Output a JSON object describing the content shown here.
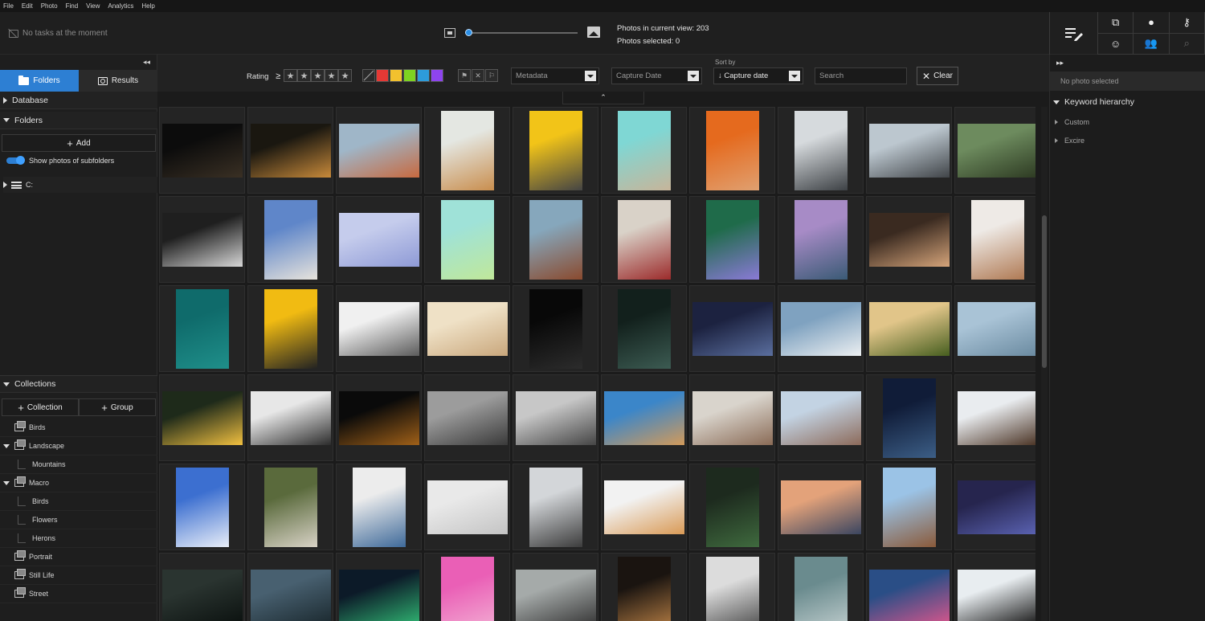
{
  "menu": [
    "File",
    "Edit",
    "Photo",
    "Find",
    "View",
    "Analytics",
    "Help"
  ],
  "header": {
    "tasks_text": "No tasks at the moment",
    "photos_in_view": "Photos in current view: 203",
    "photos_selected": "Photos selected: 0",
    "zoom_level": 0.02
  },
  "left": {
    "tab_folders": "Folders",
    "tab_results": "Results",
    "database": "Database",
    "folders": "Folders",
    "add": "Add",
    "show_subfolders": "Show photos of subfolders",
    "drive": "C:",
    "collections": "Collections",
    "collection_btn": "Collection",
    "group_btn": "Group",
    "items": [
      {
        "label": "Birds",
        "type": "collection",
        "level": 0
      },
      {
        "label": "Landscape",
        "type": "group",
        "level": 0
      },
      {
        "label": "Mountains",
        "type": "child",
        "level": 1
      },
      {
        "label": "Macro",
        "type": "group",
        "level": 0
      },
      {
        "label": "Birds",
        "type": "child",
        "level": 1
      },
      {
        "label": "Flowers",
        "type": "child",
        "level": 1
      },
      {
        "label": "Herons",
        "type": "child",
        "level": 1
      },
      {
        "label": "Portrait",
        "type": "collection",
        "level": 0
      },
      {
        "label": "Still Life",
        "type": "collection",
        "level": 0
      },
      {
        "label": "Street",
        "type": "collection",
        "level": 0
      }
    ]
  },
  "filter": {
    "rating_label": "Rating",
    "rating_op": "≥",
    "colors": [
      "#e53935",
      "#f2c12e",
      "#7ed321",
      "#2d9cdb",
      "#8e44ef"
    ],
    "metadata": "Metadata",
    "capture_date": "Capture Date",
    "sort_by_label": "Sort by",
    "sort_value": "↓ Capture date",
    "search_placeholder": "Search",
    "clear": "Clear"
  },
  "right": {
    "no_photo": "No photo selected",
    "keyword_hierarchy": "Keyword hierarchy",
    "keywords": [
      "Custom",
      "Excire"
    ]
  },
  "thumbs": [
    {
      "o": "l",
      "c": [
        "#0c0c0c",
        "#3a3024"
      ]
    },
    {
      "o": "l",
      "c": [
        "#1a1710",
        "#c88a3a"
      ]
    },
    {
      "o": "l",
      "c": [
        "#9fb6c8",
        "#c7693f"
      ]
    },
    {
      "o": "p",
      "c": [
        "#e4e7e2",
        "#c98e4e"
      ]
    },
    {
      "o": "p",
      "c": [
        "#f2c418",
        "#444"
      ]
    },
    {
      "o": "p",
      "c": [
        "#7fd7d4",
        "#c7b59a"
      ]
    },
    {
      "o": "p",
      "c": [
        "#e56a1e",
        "#e0a070"
      ]
    },
    {
      "o": "p",
      "c": [
        "#d6dadd",
        "#3d4145"
      ]
    },
    {
      "o": "l",
      "c": [
        "#bcc7cf",
        "#404448"
      ]
    },
    {
      "o": "l",
      "c": [
        "#6d8b5e",
        "#2d3a22"
      ]
    },
    {
      "o": "l",
      "c": [
        "#1f1f1f",
        "#d7d7d7"
      ]
    },
    {
      "o": "p",
      "c": [
        "#5f86c9",
        "#e7e3dc"
      ]
    },
    {
      "o": "l",
      "c": [
        "#c5ccec",
        "#8e9ad6"
      ]
    },
    {
      "o": "p",
      "c": [
        "#9fe2d8",
        "#c0e89a"
      ]
    },
    {
      "o": "p",
      "c": [
        "#86a7bc",
        "#8a4a2e"
      ]
    },
    {
      "o": "p",
      "c": [
        "#d9d2c8",
        "#9c2b2b"
      ]
    },
    {
      "o": "p",
      "c": [
        "#1f6b4a",
        "#8a7ad6"
      ]
    },
    {
      "o": "p",
      "c": [
        "#a78bc6",
        "#3a5a75"
      ]
    },
    {
      "o": "l",
      "c": [
        "#3a2a20",
        "#d5a47a"
      ]
    },
    {
      "o": "p",
      "c": [
        "#eeeae6",
        "#b07a54"
      ]
    },
    {
      "o": "p",
      "c": [
        "#0f6b6b",
        "#1f8f8a"
      ]
    },
    {
      "o": "p",
      "c": [
        "#f1bb12",
        "#222"
      ]
    },
    {
      "o": "l",
      "c": [
        "#f0f0f0",
        "#5b5b5b"
      ]
    },
    {
      "o": "l",
      "c": [
        "#efe1c6",
        "#c9a77c"
      ]
    },
    {
      "o": "p",
      "c": [
        "#080808",
        "#2c2c2c"
      ]
    },
    {
      "o": "p",
      "c": [
        "#12201c",
        "#3c5b52"
      ]
    },
    {
      "o": "l",
      "c": [
        "#1c2240",
        "#5a6e9e"
      ]
    },
    {
      "o": "l",
      "c": [
        "#7fa2c0",
        "#eceff1"
      ]
    },
    {
      "o": "l",
      "c": [
        "#e1c589",
        "#465e1f"
      ]
    },
    {
      "o": "l",
      "c": [
        "#a9c3d6",
        "#6a8aa0"
      ]
    },
    {
      "o": "l",
      "c": [
        "#1e2a1a",
        "#f1c040"
      ]
    },
    {
      "o": "l",
      "c": [
        "#e7e7e7",
        "#2c2c2c"
      ]
    },
    {
      "o": "l",
      "c": [
        "#0a0a0a",
        "#a06018"
      ]
    },
    {
      "o": "l",
      "c": [
        "#9c9c9c",
        "#3a3a3a"
      ]
    },
    {
      "o": "l",
      "c": [
        "#c7c7c7",
        "#454545"
      ]
    },
    {
      "o": "l",
      "c": [
        "#3b86c9",
        "#d29a5a"
      ]
    },
    {
      "o": "l",
      "c": [
        "#d9d4cc",
        "#8a6b56"
      ]
    },
    {
      "o": "l",
      "c": [
        "#c3d3e3",
        "#8c6a5a"
      ]
    },
    {
      "o": "p",
      "c": [
        "#101c38",
        "#3c5e86"
      ]
    },
    {
      "o": "l",
      "c": [
        "#e9ecef",
        "#4a3324"
      ]
    },
    {
      "o": "p",
      "c": [
        "#3c6fd0",
        "#e9eef8"
      ]
    },
    {
      "o": "p",
      "c": [
        "#5a6a3c",
        "#d8d2c6"
      ]
    },
    {
      "o": "p",
      "c": [
        "#ececec",
        "#3f6a9a"
      ]
    },
    {
      "o": "l",
      "c": [
        "#e9e9e9",
        "#c4c4c4"
      ]
    },
    {
      "o": "p",
      "c": [
        "#d3d6d9",
        "#3c3c3c"
      ]
    },
    {
      "o": "l",
      "c": [
        "#f2f2f2",
        "#d99a56"
      ]
    },
    {
      "o": "p",
      "c": [
        "#1d2a1e",
        "#3f6a3e"
      ]
    },
    {
      "o": "l",
      "c": [
        "#e3a27a",
        "#3a4560"
      ]
    },
    {
      "o": "p",
      "c": [
        "#9bc3e6",
        "#8a5a3a"
      ]
    },
    {
      "o": "l",
      "c": [
        "#26254e",
        "#5a62b2"
      ]
    },
    {
      "o": "l",
      "c": [
        "#2a3430",
        "#0c1210"
      ]
    },
    {
      "o": "l",
      "c": [
        "#486070",
        "#1c2a30"
      ]
    },
    {
      "o": "l",
      "c": [
        "#0c1a28",
        "#2fb070"
      ]
    },
    {
      "o": "p",
      "c": [
        "#ea5fb6",
        "#f3b5d6"
      ]
    },
    {
      "o": "l",
      "c": [
        "#a5aaa9",
        "#3a3a3a"
      ]
    },
    {
      "o": "p",
      "c": [
        "#1a1410",
        "#c88a4a"
      ]
    },
    {
      "o": "p",
      "c": [
        "#dcdcdc",
        "#3a3a3a"
      ]
    },
    {
      "o": "p",
      "c": [
        "#6a8b8e",
        "#c9d4d4"
      ]
    },
    {
      "o": "l",
      "c": [
        "#2a4e86",
        "#d3568c"
      ]
    },
    {
      "o": "l",
      "c": [
        "#e8edf0",
        "#1c1c1c"
      ]
    }
  ]
}
